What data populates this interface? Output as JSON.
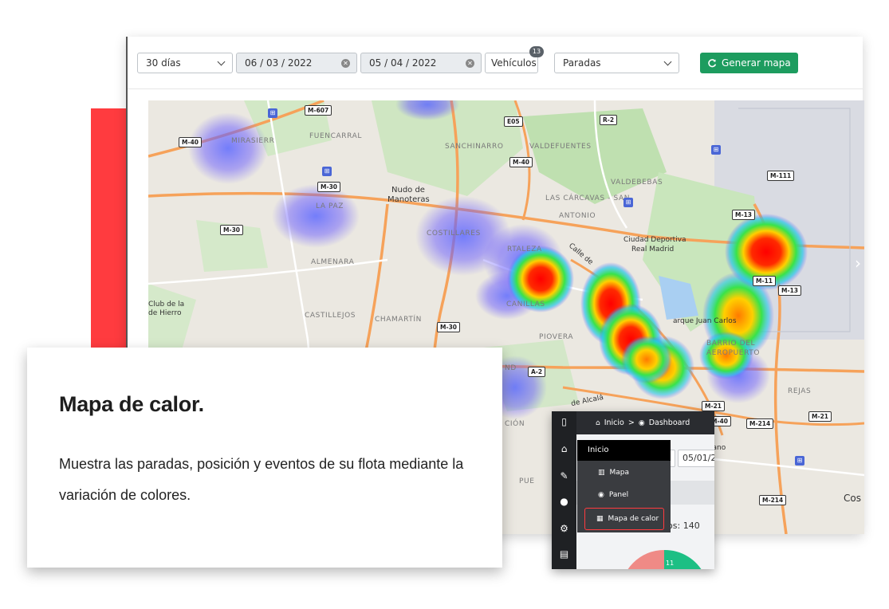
{
  "filters": {
    "period": "30 días",
    "date_from": "06 / 03 / 2022",
    "date_to": "05 / 04 / 2022",
    "vehicles_label": "Vehículos",
    "vehicles_count": "13",
    "type": "Paradas",
    "generate_label": "Generar mapa"
  },
  "map": {
    "labels": {
      "mirasierra": "MIRASIERR",
      "fuencarral": "FUENCARRAL",
      "sanchinarro": "SANCHINARRO",
      "valdefuentes": "VALDEFUENTES",
      "valdebebas": "VALDEBEBAS",
      "nudo1": "Nudo de",
      "nudo2": "Manoteras",
      "lapaz": "LA PAZ",
      "costillares": "COSTILLARES",
      "carcavas1": "LAS CÁRCAVAS - SAN",
      "carcavas2": "ANTONIO",
      "ciudad1": "Ciudad Deportiva",
      "ciudad2": "Real Madrid",
      "almenara": "ALMENARA",
      "ortaleza": "RTALEZA",
      "canillas": "CANILLAS",
      "calle": "Calle de",
      "parque": "arque Juan Carlos",
      "club1": "Club de la",
      "club2": "de Hierro",
      "castillejos": "CASTILLEJOS",
      "chamartin": "CHAMARTÍN",
      "piovera": "PIOVERA",
      "barrio1": "BARRIO DEL",
      "barrio2": "AEROPUERTO",
      "rejas": "REJAS",
      "alcala": "de Alcalá",
      "cion": "CIÓN",
      "pue": "PUE",
      "tano": "tano",
      "cos": "Cos",
      "nd": "ND"
    },
    "road_shields": {
      "m607": "M-607",
      "m40a": "M-40",
      "e05": "E05",
      "r2": "R-2",
      "m30a": "M-30",
      "m40b": "M-40",
      "m111": "M-111",
      "m30b": "M-30",
      "m13a": "M-13",
      "m13b": "M-13",
      "m11": "M-11",
      "m30c": "M-30",
      "a2": "A-2",
      "m21a": "M-21",
      "m40c": "M-40",
      "m214a": "M-214",
      "m21b": "M-21",
      "m214b": "M-214"
    }
  },
  "card": {
    "title": "Mapa de calor.",
    "description": "Muestra las paradas, posición y eventos de su flota mediante la variación de colores."
  },
  "popup": {
    "breadcrumb_home": "Inicio",
    "breadcrumb_sep": ">",
    "breadcrumb_current": "Dashboard",
    "date_value": "05/01/2",
    "count_text": "los: 140",
    "pie_label": "11",
    "menu": {
      "header": "Inicio",
      "items": [
        "Mapa",
        "Panel",
        "Mapa de calor"
      ]
    }
  }
}
